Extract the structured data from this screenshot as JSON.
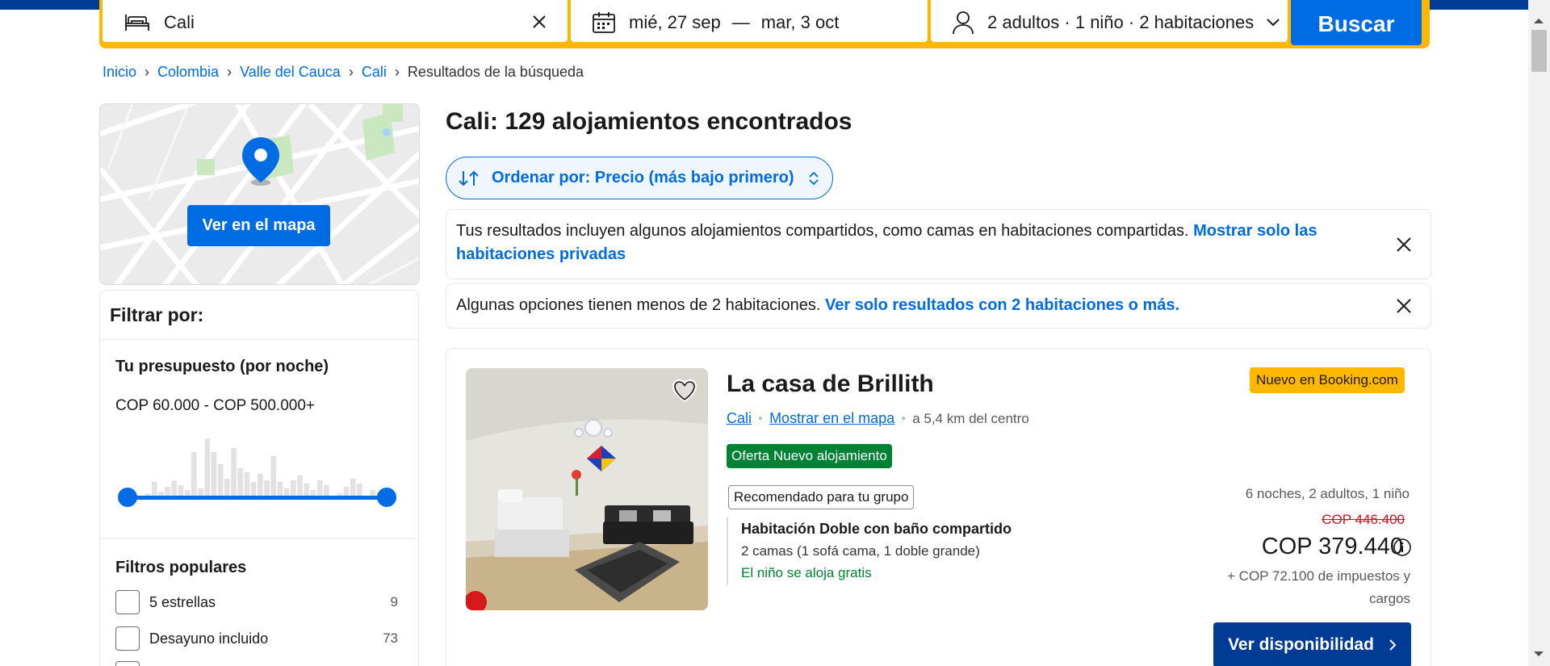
{
  "search": {
    "destination": "Cali",
    "checkin": "mié, 27 sep",
    "dash": "—",
    "checkout": "mar, 3 oct",
    "guests": "2 adultos · 1 niño · 2 habitaciones",
    "button": "Buscar"
  },
  "breadcrumb": [
    "Inicio",
    "Colombia",
    "Valle del Cauca",
    "Cali",
    "Resultados de la búsqueda"
  ],
  "map": {
    "button": "Ver en el mapa"
  },
  "filters": {
    "title": "Filtrar por:",
    "budget_title": "Tu presupuesto (por noche)",
    "budget_range": "COP 60.000 - COP 500.000+",
    "popular_title": "Filtros populares",
    "popular": [
      {
        "label": "5 estrellas",
        "count": "9"
      },
      {
        "label": "Desayuno incluido",
        "count": "73"
      }
    ]
  },
  "results": {
    "title": "Cali: 129 alojamientos encontrados",
    "sort_label": "Ordenar por: Precio (más bajo primero)",
    "notice1_text": "Tus resultados incluyen algunos alojamientos compartidos, como camas en habitaciones compartidas.",
    "notice1_link": "Mostrar solo las habitaciones privadas",
    "notice2_text": "Algunas opciones tienen menos de 2 habitaciones.",
    "notice2_link": "Ver solo resultados con 2 habitaciones o más."
  },
  "property": {
    "name": "La casa de Brillith",
    "badge": "Nuevo en Booking.com",
    "city": "Cali",
    "map_link": "Mostrar en el mapa",
    "distance": "a 5,4 km del centro",
    "offer": "Oferta Nuevo alojamiento",
    "recommended": "Recomendado para tu grupo",
    "room_name": "Habitación Doble con baño compartido",
    "room_beds": "2 camas (1 sofá cama, 1 doble grande)",
    "room_kid": "El niño se aloja gratis",
    "nights": "6 noches, 2 adultos, 1 niño",
    "old_price": "COP 446.400",
    "price": "COP 379.440",
    "taxes": "+ COP 72.100 de impuestos y cargos",
    "button": "Ver disponibilidad"
  },
  "colors": {
    "brand_dark": "#003b95",
    "accent": "#006ce4",
    "yellow": "#ffb700",
    "green": "#008234",
    "red": "#d4111e"
  }
}
